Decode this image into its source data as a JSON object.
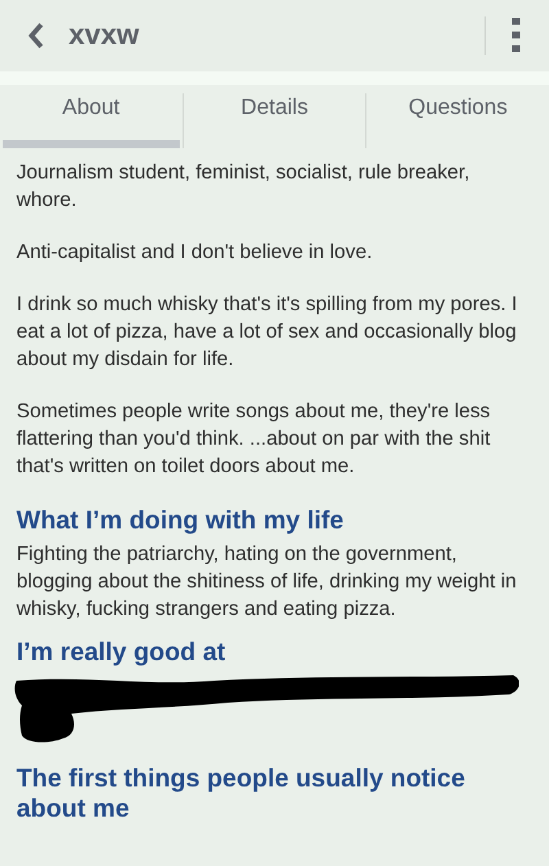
{
  "header": {
    "title": "xvxw"
  },
  "tabs": [
    {
      "label": "About",
      "selected": true
    },
    {
      "label": "Details",
      "selected": false
    },
    {
      "label": "Questions",
      "selected": false
    }
  ],
  "sections": [
    {
      "kind": "paragraph",
      "text": "Journalism student, feminist, socialist, rule breaker, whore."
    },
    {
      "kind": "paragraph",
      "text": "Anti-capitalist and I don't believe in love."
    },
    {
      "kind": "paragraph",
      "text": "I drink so much whisky that's it's spilling from my pores. I eat a lot of pizza, have a lot of sex and occasionally blog about my disdain for life."
    },
    {
      "kind": "paragraph",
      "text": "Sometimes people write songs about me, they're less flattering than you'd think. ...about on par with the shit that's written on toilet doors about me."
    },
    {
      "kind": "heading",
      "text": "What I’m doing with my life"
    },
    {
      "kind": "body",
      "text": "Fighting the patriarchy, hating on the government, blogging about the shitiness of life, drinking my weight in whisky, fucking strangers and eating pizza."
    },
    {
      "kind": "heading",
      "text": "I’m really good at"
    },
    {
      "kind": "redacted"
    },
    {
      "kind": "heading",
      "text": "The first things people usually notice about me"
    }
  ]
}
